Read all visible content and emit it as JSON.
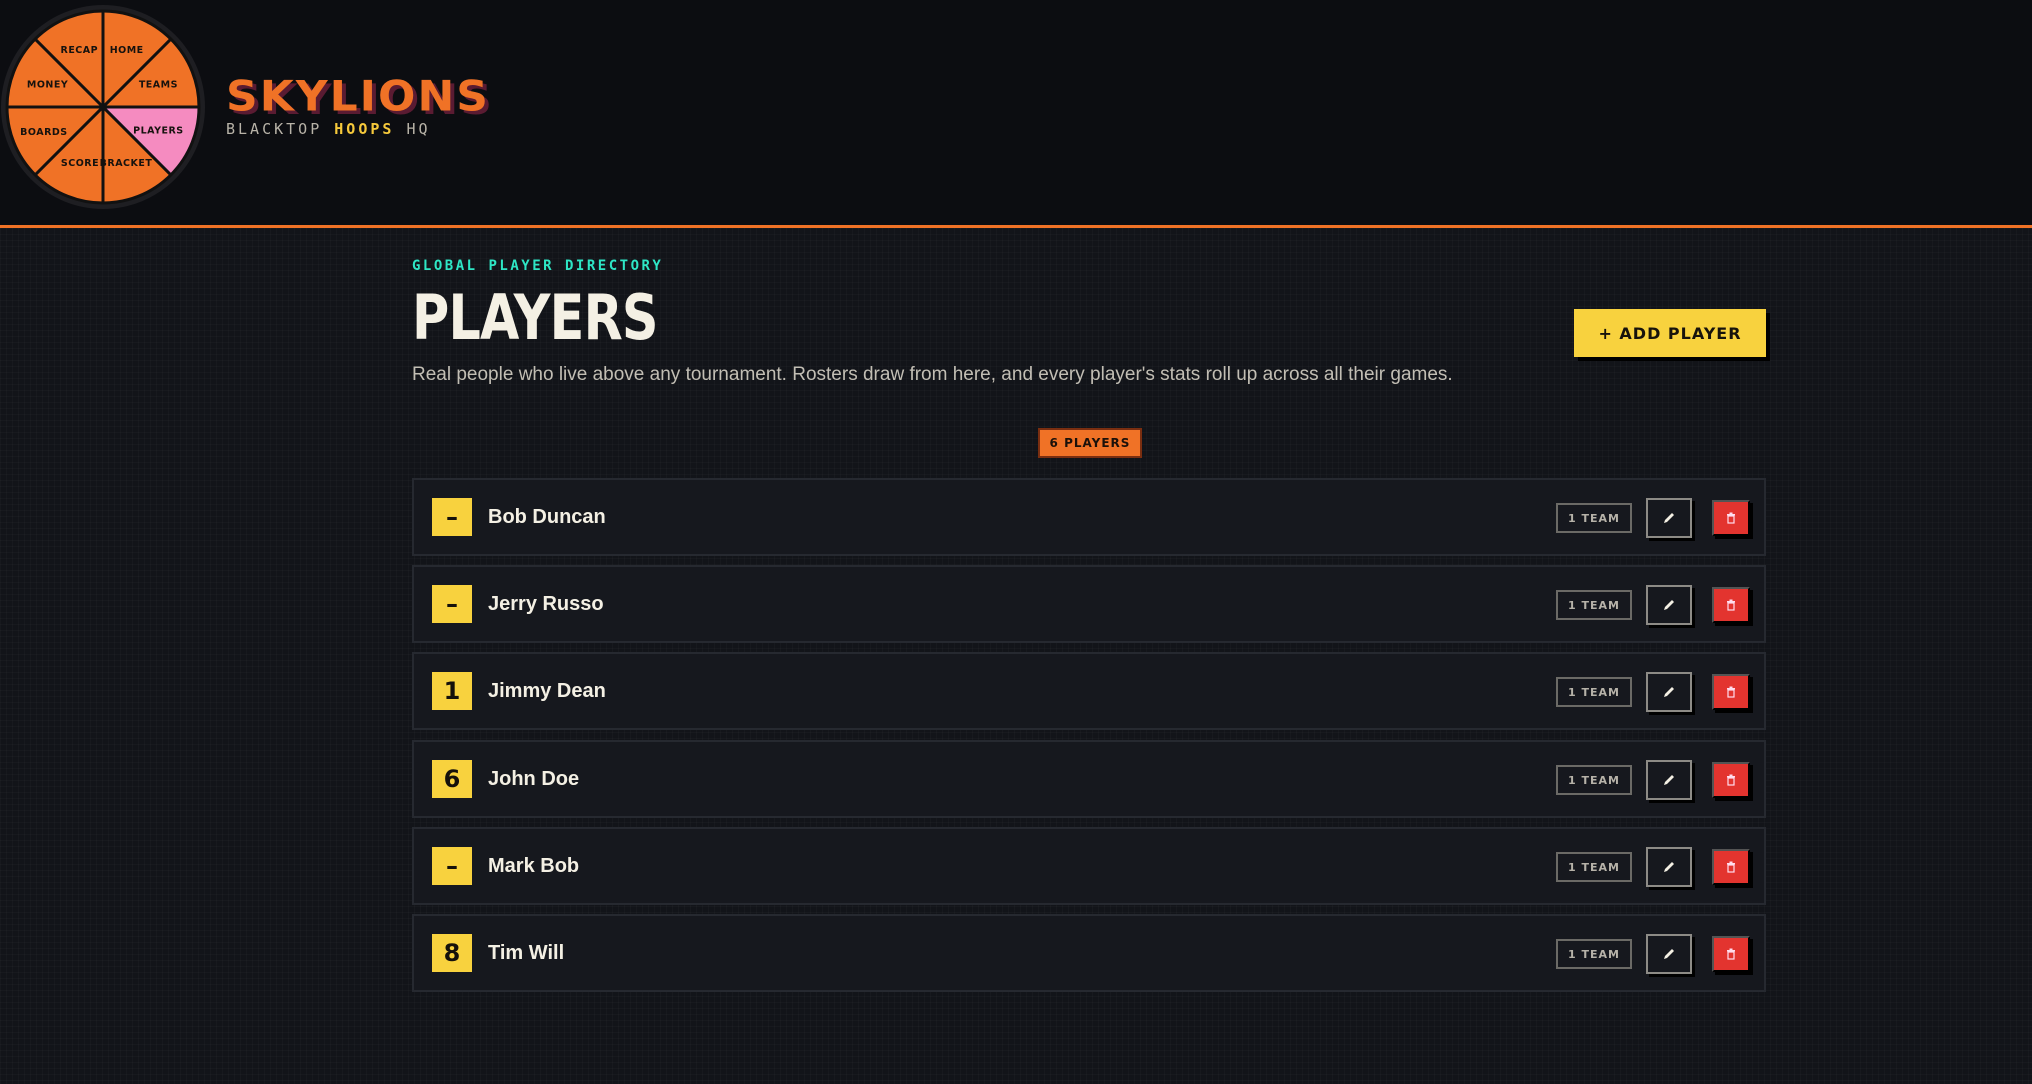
{
  "brand": {
    "name": "SKYLIONS",
    "tagline_pre": "BLACKTOP ",
    "tagline_highlight": "HOOPS",
    "tagline_post": " HQ"
  },
  "nav": {
    "active": "PLAYERS",
    "items": [
      "RECAP",
      "HOME",
      "TEAMS",
      "PLAYERS",
      "BRACKET",
      "SCORE",
      "BOARDS",
      "MONEY"
    ]
  },
  "page": {
    "eyebrow": "GLOBAL PLAYER DIRECTORY",
    "title": "PLAYERS",
    "description": "Real people who live above any tournament. Rosters draw from here, and every player's stats roll up across all their games.",
    "add_button": "+ ADD PLAYER",
    "count_badge": "6 PLAYERS"
  },
  "players": [
    {
      "number": "–",
      "name": "Bob Duncan",
      "teams": "1 TEAM"
    },
    {
      "number": "–",
      "name": "Jerry Russo",
      "teams": "1 TEAM"
    },
    {
      "number": "1",
      "name": "Jimmy Dean",
      "teams": "1 TEAM"
    },
    {
      "number": "6",
      "name": "John Doe",
      "teams": "1 TEAM"
    },
    {
      "number": "–",
      "name": "Mark Bob",
      "teams": "1 TEAM"
    },
    {
      "number": "8",
      "name": "Tim Will",
      "teams": "1 TEAM"
    }
  ],
  "colors": {
    "accent_orange": "#f07226",
    "accent_yellow": "#f8d23e",
    "accent_teal": "#2ee6c5",
    "nav_active_pink": "#f58bc0",
    "danger_red": "#e3342f"
  },
  "icons": {
    "edit": "pencil-icon",
    "delete": "trash-icon"
  }
}
